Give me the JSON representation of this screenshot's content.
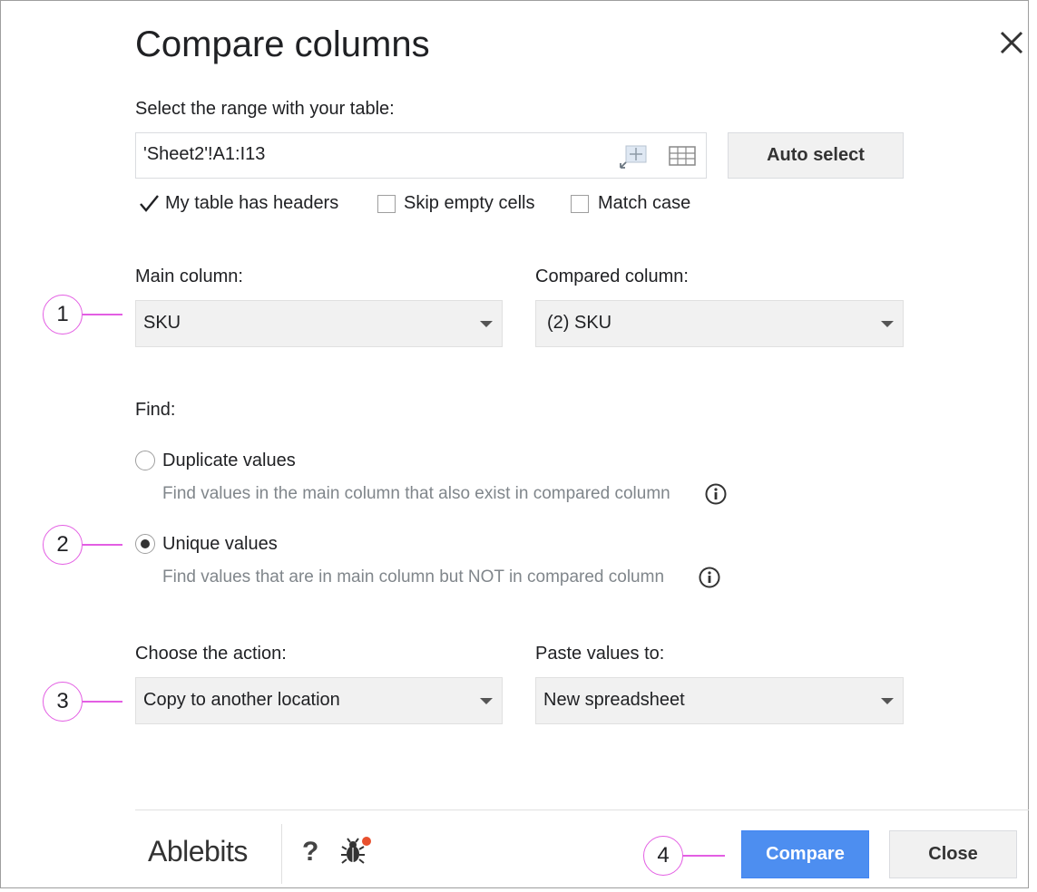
{
  "dialog": {
    "title": "Compare columns"
  },
  "range": {
    "label": "Select the range with your table:",
    "value": "'Sheet2'!A1:I13",
    "auto_select_label": "Auto select"
  },
  "options": {
    "headers": {
      "label": "My table has headers",
      "checked": true
    },
    "skip_empty": {
      "label": "Skip empty cells",
      "checked": false
    },
    "match_case": {
      "label": "Match case",
      "checked": false
    }
  },
  "columns": {
    "main_label": "Main column:",
    "main_value": "SKU",
    "compared_label": "Compared column:",
    "compared_value": "(2) SKU"
  },
  "find": {
    "label": "Find:",
    "duplicate": {
      "label": "Duplicate values",
      "desc": "Find values in the main column that also exist in compared column",
      "selected": false
    },
    "unique": {
      "label": "Unique values",
      "desc": "Find values that are in main column but NOT in compared column",
      "selected": true
    }
  },
  "action": {
    "label": "Choose the action:",
    "value": "Copy to another location",
    "paste_label": "Paste values to:",
    "paste_value": "New spreadsheet"
  },
  "callouts": [
    "1",
    "2",
    "3",
    "4"
  ],
  "footer": {
    "logo": "Ablebits",
    "help": "?",
    "compare_label": "Compare",
    "close_label": "Close"
  },
  "icons": [
    "close-icon",
    "range-select-icon",
    "table-grid-icon",
    "checkmark-icon",
    "dropdown-caret-icon",
    "info-icon",
    "bug-icon"
  ],
  "colors": {
    "accent": "#4d8ef0",
    "callout": "#e35ee3",
    "bug_badge": "#e8502e"
  }
}
